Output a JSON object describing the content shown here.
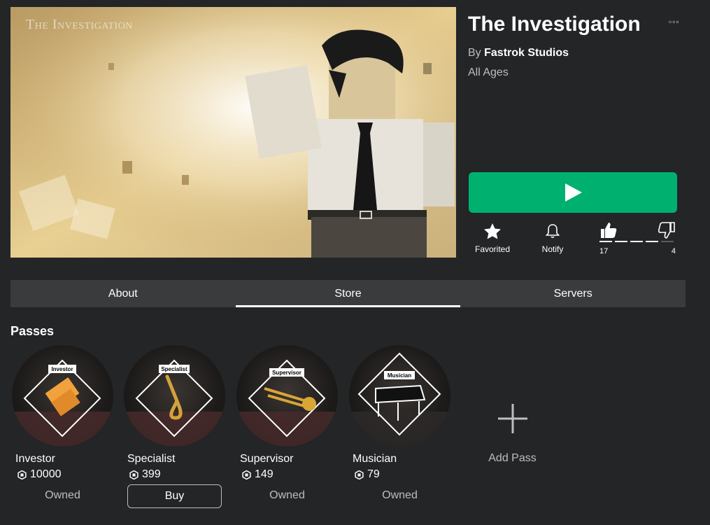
{
  "game": {
    "thumbnail_caption": "The Investigation",
    "title": "The Investigation",
    "by_prefix": "By",
    "creator": "Fastrok Studios",
    "age_rating": "All Ages"
  },
  "actions": {
    "favorite_label": "Favorited",
    "notify_label": "Notify",
    "upvotes": "17",
    "downvotes": "4",
    "vote_ratio": 0.81
  },
  "tabs": [
    {
      "label": "About"
    },
    {
      "label": "Store",
      "active": true
    },
    {
      "label": "Servers"
    }
  ],
  "store": {
    "section_title": "Passes",
    "passes": [
      {
        "name": "Investor",
        "price": "10000",
        "badge": "Investor",
        "status": "Owned"
      },
      {
        "name": "Specialist",
        "price": "399",
        "badge": "Specialist",
        "button": "Buy"
      },
      {
        "name": "Supervisor",
        "price": "149",
        "badge": "Supervisor",
        "status": "Owned"
      },
      {
        "name": "Musician",
        "price": "79",
        "badge": "Musician",
        "status": "Owned"
      }
    ],
    "add_pass_label": "Add Pass"
  },
  "colors": {
    "background": "#232527",
    "play_button": "#00b06f",
    "tab_bar": "#393b3d",
    "secondary_text": "#bdbebe"
  },
  "icons": [
    "more-icon",
    "play-icon",
    "star-icon",
    "bell-icon",
    "thumbs-up-icon",
    "thumbs-down-icon",
    "robux-icon",
    "plus-icon"
  ]
}
